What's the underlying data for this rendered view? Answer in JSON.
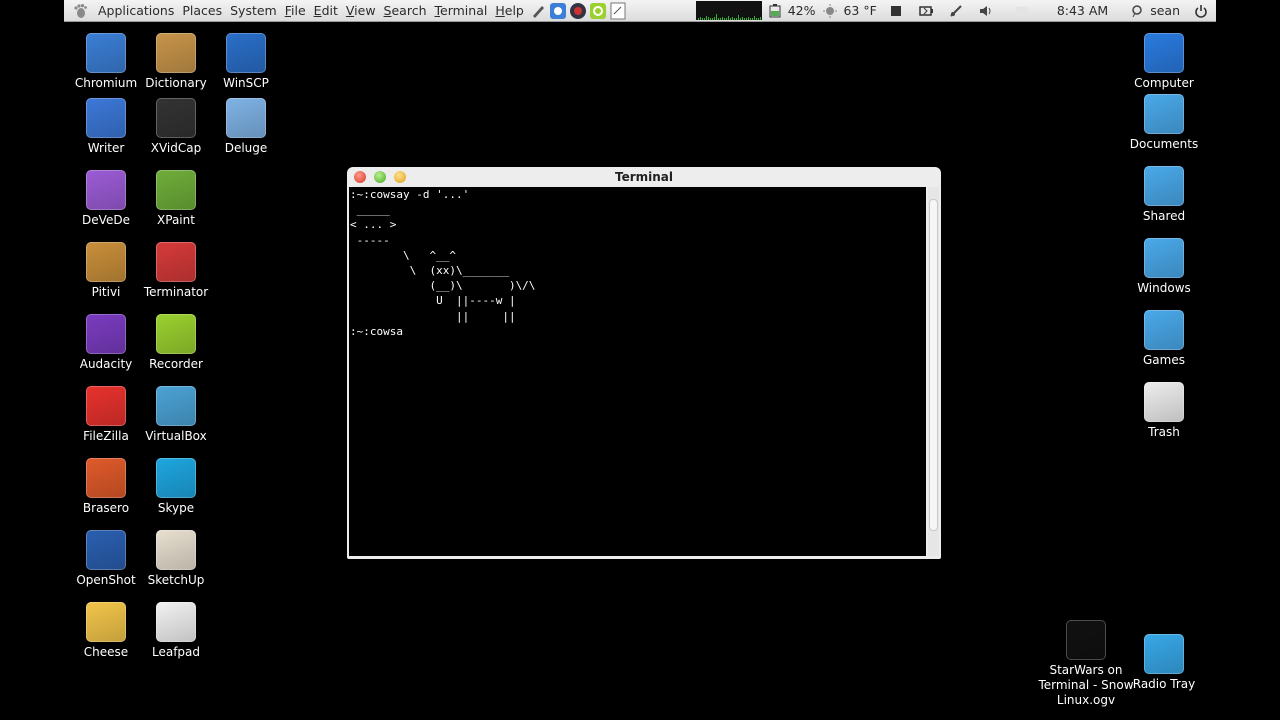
{
  "panel": {
    "menus": [
      {
        "label": "Applications"
      },
      {
        "label": "Places"
      },
      {
        "label": "System"
      },
      {
        "label": "File",
        "u": "F",
        "rest": "ile"
      },
      {
        "label": "Edit",
        "u": "E",
        "rest": "dit"
      },
      {
        "label": "View",
        "u": "V",
        "rest": "iew"
      },
      {
        "label": "Search",
        "u": "S",
        "rest": "earch"
      },
      {
        "label": "Terminal",
        "u": "T",
        "rest": "erminal"
      },
      {
        "label": "Help",
        "u": "H",
        "rest": "elp"
      }
    ],
    "battery": "42%",
    "weather": "63 °F",
    "clock": "8:43 AM",
    "user": "sean"
  },
  "desktop_left": [
    {
      "label": "Chromium",
      "icon": "chromium-icon",
      "color": "#3b7fd6"
    },
    {
      "label": "Dictionary",
      "icon": "dictionary-icon",
      "color": "#c8954a"
    },
    {
      "label": "WinSCP",
      "icon": "winscp-icon",
      "color": "#2a6fc9"
    },
    {
      "label": "Writer",
      "icon": "writer-icon",
      "color": "#3c78d8"
    },
    {
      "label": "XVidCap",
      "icon": "xvidcap-icon",
      "color": "#333333"
    },
    {
      "label": "Deluge",
      "icon": "deluge-icon",
      "color": "#7fb3e6"
    },
    {
      "label": "DeVeDe",
      "icon": "devede-icon",
      "color": "#9c5cd6"
    },
    {
      "label": "XPaint",
      "icon": "xpaint-icon",
      "color": "#6fae3a"
    },
    {
      "label": "Pitivi",
      "icon": "pitivi-icon",
      "color": "#c98f3a"
    },
    {
      "label": "Terminator",
      "icon": "terminator-icon",
      "color": "#d63a3a"
    },
    {
      "label": "Audacity",
      "icon": "audacity-icon",
      "color": "#7a3cc0"
    },
    {
      "label": "Recorder",
      "icon": "recorder-icon",
      "color": "#9bd12f"
    },
    {
      "label": "FileZilla",
      "icon": "filezilla-icon",
      "color": "#e8322d"
    },
    {
      "label": "VirtualBox",
      "icon": "virtualbox-icon",
      "color": "#4ba3d6"
    },
    {
      "label": "Brasero",
      "icon": "brasero-icon",
      "color": "#e05a2a"
    },
    {
      "label": "Skype",
      "icon": "skype-icon",
      "color": "#1ea6e0"
    },
    {
      "label": "OpenShot",
      "icon": "openshot-icon",
      "color": "#2a5fb0"
    },
    {
      "label": "SketchUp",
      "icon": "sketchup-icon",
      "color": "#e8e0d0"
    },
    {
      "label": "Cheese",
      "icon": "cheese-icon",
      "color": "#f3c64a"
    },
    {
      "label": "Leafpad",
      "icon": "leafpad-icon",
      "color": "#f2f2f2"
    }
  ],
  "desktop_right": [
    {
      "label": "Computer",
      "icon": "computer-icon",
      "color": "#2a7be0"
    },
    {
      "label": "Documents",
      "icon": "documents-folder-icon",
      "color": "#4aa9ea"
    },
    {
      "label": "Shared",
      "icon": "shared-folder-icon",
      "color": "#4aa9ea"
    },
    {
      "label": "Windows",
      "icon": "windows-folder-icon",
      "color": "#4aa9ea"
    },
    {
      "label": "Games",
      "icon": "games-folder-icon",
      "color": "#4aa9ea"
    },
    {
      "label": "Trash",
      "icon": "trash-icon",
      "color": "#eeeeee"
    }
  ],
  "desktop_bottom": [
    {
      "label": "StarWars on Terminal - Snow Linux.ogv",
      "icon": "video-file-icon",
      "color": "#111111"
    },
    {
      "label": "Radio Tray",
      "icon": "radio-tray-icon",
      "color": "#38a8e8"
    }
  ],
  "terminal": {
    "title": "Terminal",
    "output": ":~:cowsay -d '...'\n _____\n< ... >\n -----\n        \\   ^__^\n         \\  (xx)\\_______\n            (__)\\       )\\/\\\n             U  ||----w |\n                ||     ||\n:~:cowsa"
  }
}
